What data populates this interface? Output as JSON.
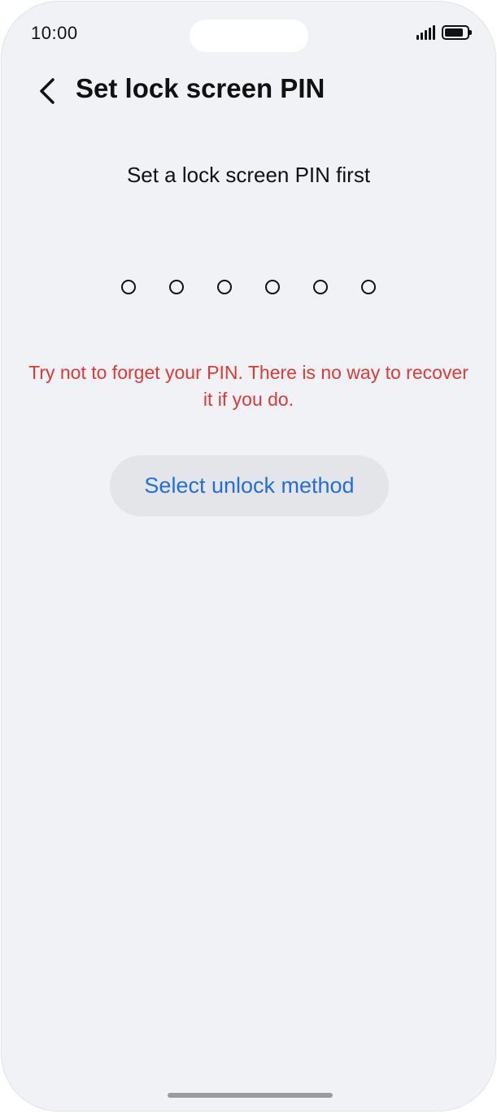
{
  "status_bar": {
    "time": "10:00",
    "signal_icon": "signal-bars-icon",
    "battery_icon": "battery-icon",
    "battery_level": 0.85
  },
  "header": {
    "back_icon": "chevron-left-icon",
    "title": "Set lock screen PIN"
  },
  "main": {
    "prompt": "Set a lock screen PIN first",
    "pin_length": 6,
    "pin_entered": 0,
    "warning": "Try not to forget your PIN. There is no way to recover it if you do.",
    "unlock_button_label": "Select unlock method"
  },
  "colors": {
    "background": "#f1f2f5",
    "warning": "#e03a35",
    "accent": "#1f6fe0",
    "button_bg": "#e4e5e9"
  }
}
